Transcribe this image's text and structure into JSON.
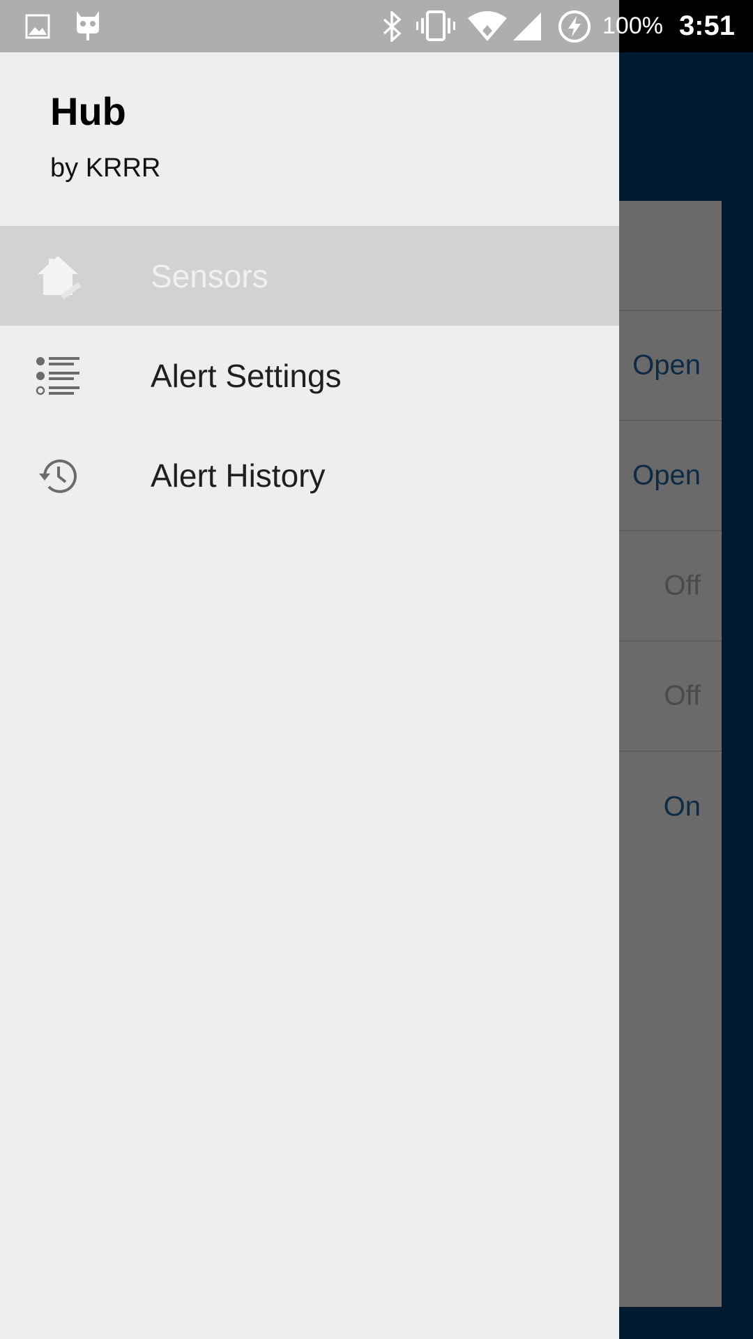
{
  "status_bar": {
    "icons": [
      "image-icon",
      "cyanogen-icon",
      "bluetooth-icon",
      "vibrate-icon",
      "wifi-icon",
      "signal-icon",
      "battery-charging-icon"
    ],
    "battery": "100%",
    "time": "3:51"
  },
  "background": {
    "rows": [
      {
        "value": "Open",
        "color": "#0e2a45"
      },
      {
        "value": "Open",
        "color": "#0e2a45"
      },
      {
        "value": "Off",
        "color": "#4a4a4a"
      },
      {
        "value": "Off",
        "color": "#4a4a4a"
      },
      {
        "value": "On",
        "color": "#0e2a45"
      }
    ]
  },
  "drawer": {
    "title": "Hub",
    "subtitle": "by KRRR",
    "items": [
      {
        "label": "Sensors",
        "icon": "home-icon",
        "selected": true
      },
      {
        "label": "Alert Settings",
        "icon": "list-icon",
        "selected": false
      },
      {
        "label": "Alert History",
        "icon": "history-icon",
        "selected": false
      }
    ]
  },
  "colors": {
    "drawer_bg": "#eeeeee",
    "selected_bg": "#d2d2d2",
    "app_bg": "#001b30"
  }
}
